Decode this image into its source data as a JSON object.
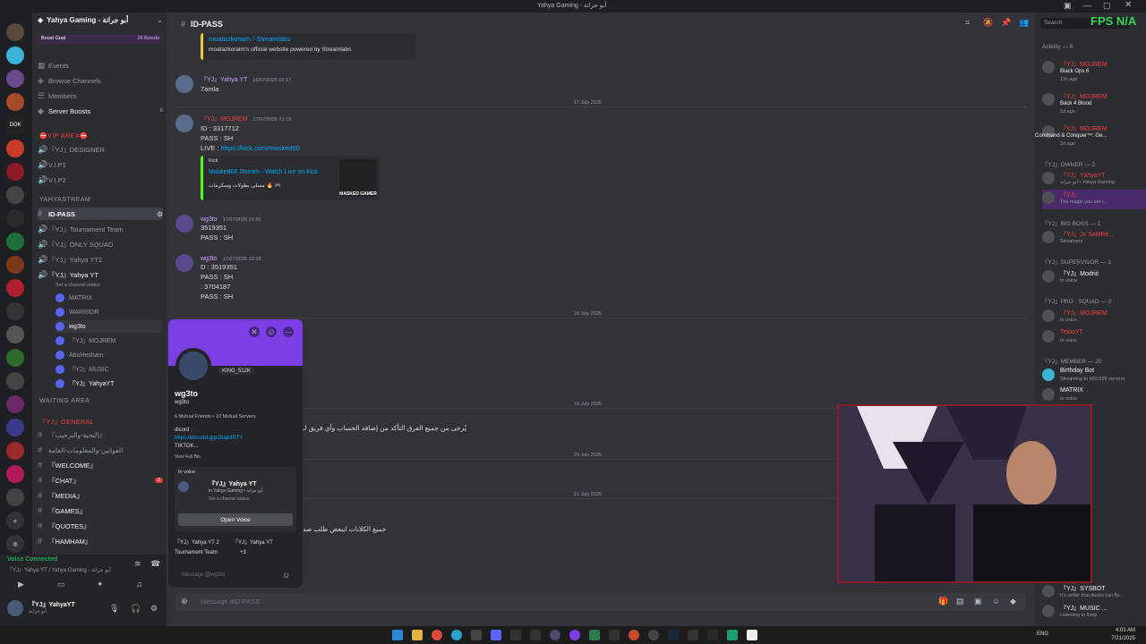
{
  "window": {
    "title": "Yahya Gaming - أبو جراتة"
  },
  "server": {
    "name": "Yahya Gaming - أبو جراتة",
    "boost_goal": "Boost Goal",
    "boost_count": "26 Boosts"
  },
  "sidebar": {
    "top_items": [
      {
        "label": "Events",
        "icon": "calendar-icon"
      },
      {
        "label": "Browse Channels",
        "icon": "compass-icon"
      },
      {
        "label": "Members",
        "icon": "members-icon"
      },
      {
        "label": "Server Boosts",
        "icon": "boost-icon",
        "count": "6"
      }
    ],
    "categories": [
      {
        "label": "⛔VIP AREA⛔"
      },
      {
        "label": "YAHYASTREAM"
      },
      {
        "label": "WAITING AREA"
      },
      {
        "label": "『YJ』GENERAL"
      }
    ],
    "vip_channels": [
      "『YJ』DESIGNER",
      "V.I.P1",
      "V.I.P2"
    ],
    "stream_channels": [
      "ID-PASS",
      "『YJ』Tournament Team",
      "『YJ』ONLY SQUAD",
      "『YJ』Yahya YT2",
      "『YJ』Yahya YT"
    ],
    "channel_status": "Set a channel status",
    "voice_users": [
      "MATRIX",
      "WARRIOR",
      "wg3to",
      "『YJ』MOJREM",
      "AbuHesham",
      "『YJ』MUSIC",
      "『YJ』YahyaYT"
    ],
    "general_channels": [
      "『التحية-والترحيب』",
      "القوانين-والمعلومات-العامة",
      "『WELCOME』",
      "『CHAT』",
      "『MEDIA』",
      "『GAMES』",
      "『QUOTES』",
      "『HAMHAM』"
    ],
    "chat_badge": "2"
  },
  "voice": {
    "status": "Voice Connected",
    "channel": "『YJ』Yahya YT / Yahya Gaming - أبو جراتة"
  },
  "user": {
    "name": "『YJ』YahyaYT",
    "tag": "أبو جراتة"
  },
  "channel": {
    "name": "ID-PASS",
    "composer_placeholder": "Message #ID-PASS"
  },
  "messages": [
    {
      "embed_title": "moatazkoraim / Streamlabs",
      "embed_desc": "moatazkoraim's official website powered by Streamlabs"
    },
    {
      "author": "『YJ』Yahya YT",
      "time": "16/07/2025 02:17",
      "lines": [
        "7amla"
      ]
    },
    {
      "divider": "17 July 2025"
    },
    {
      "author": "『YJ』MOJREM",
      "time": "17/07/2025 21:19",
      "lines": [
        "ID : 3317712",
        "PASS : SH"
      ],
      "live_label": "LIVE :",
      "live_link": "https://kick.com/masked00",
      "embed_site": "Kick",
      "embed_title": "Masked00 Stream - Watch Live on Kick",
      "embed_desc": "مسلي بطولات وسكرمات 🔥 🎮",
      "embed_thumb": "MASKED GAMER"
    },
    {
      "author": "wg3to",
      "time": "17/07/2025 21:55",
      "lines": [
        "3519351",
        "PASS : SH"
      ]
    },
    {
      "author": "wg3to",
      "time": "17/07/2025 22:33",
      "lines": [
        "D : 3519351",
        "PASS : SH",
        ": 3704187",
        "PASS : SH"
      ]
    },
    {
      "divider": "18 July 2025"
    },
    {
      "divider": "19 July 2025"
    },
    {
      "author": "",
      "time": "",
      "lines": [
        "يُرجى من جميع الفرق التأكد من إضافة الحساب وأي فريق لـ"
      ]
    },
    {
      "divider": "20 July 2025"
    },
    {
      "divider": "21 July 2025"
    },
    {
      "author": "",
      "time": "",
      "lines": [
        "جميع الكلانات ايبعض طلب صد"
      ]
    }
  ],
  "profile": {
    "name": "wg3to",
    "username": "wg3to",
    "clan": "KING_512K",
    "mutual": "6 Mutual Friends • 10 Mutual Servers",
    "bio_label": "dicord :",
    "bio_link": "https://discord.gg/JXap3RTY",
    "bio_extra": "TIKTOK...",
    "view_bio": "View Full Bio",
    "in_voice": "In voice",
    "voice_channel": "『YJ』Yahya YT",
    "voice_server": "in Yahya Gaming • أبو جراتة",
    "voice_status": "Set a channel status",
    "open_voice": "Open Voice",
    "roles": [
      "『YJ』Yahya YT 2",
      "『YJ』Yahya YT",
      "Tournament Team",
      "+3"
    ],
    "message_placeholder": "Message @wg3to"
  },
  "members": {
    "activity_label": "Activity — 6",
    "activities": [
      {
        "name": "『YJ』MOJREM",
        "game": "Black Ops 6",
        "time": "11h ago"
      },
      {
        "name": "『YJ』MOJREM",
        "game": "Back 4 Blood",
        "time": "1d ago"
      },
      {
        "name": "『YJ』MOJREM",
        "game": "Command & Conquer™: Ge...",
        "time": "2d ago"
      }
    ],
    "groups": [
      {
        "label": "『YJ』OWNER — 2",
        "members": [
          {
            "name": "『YJ』YahyaYT",
            "status": "أبو جراتة • Yahya Gaming"
          },
          {
            "name": "『YJ』",
            "status": "The magic you are l..."
          }
        ]
      },
      {
        "label": "『YJ』BIG BOSS — 1",
        "members": [
          {
            "name": "『YJ』Jc SaMRe...",
            "status": "Streamers"
          }
        ]
      },
      {
        "label": "『YJ』SUPERVISOR — 1",
        "members": [
          {
            "name": "『YJ』Modrić",
            "status": "In voice"
          }
        ]
      },
      {
        "label": "『YJ』PRO - SQUAD — 2",
        "members": [
          {
            "name": "『YJ』MOJREM",
            "status": "In voice"
          },
          {
            "name": "TelooYT",
            "status": "In voice"
          }
        ]
      },
      {
        "label": "『YJ』MEMBER — 20",
        "members": [
          {
            "name": "Birthday Bot",
            "status": "Streaming to 662,009 servers"
          },
          {
            "name": "MATRIX",
            "status": "In voice"
          }
        ]
      }
    ],
    "bottom": [
      {
        "name": "『YJ』SYSBOT",
        "status": "It's unfair that ducks can fly..."
      },
      {
        "name": "『YJ』MUSIC ...",
        "status": "Listening to /help"
      }
    ]
  },
  "top_right": {
    "search_placeholder": "Search",
    "fps_label": "FPS",
    "fps_value": "N/A"
  },
  "taskbar": {
    "lang": "ENG",
    "time": "4:03 AM",
    "date": "7/21/2025"
  },
  "colors": {
    "accent": "#5865f2",
    "banner": "#7b3fe4",
    "fps": "#3ad35a",
    "danger": "#f23f43"
  }
}
